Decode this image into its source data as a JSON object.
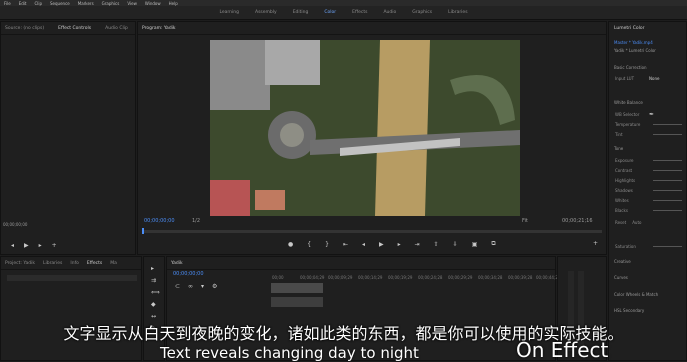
{
  "menu": [
    "File",
    "Edit",
    "Clip",
    "Sequence",
    "Markers",
    "Graphics",
    "View",
    "Window",
    "Help"
  ],
  "workspaces": [
    {
      "label": "Learning",
      "active": false
    },
    {
      "label": "Assembly",
      "active": false
    },
    {
      "label": "Editing",
      "active": false
    },
    {
      "label": "Color",
      "active": true
    },
    {
      "label": "Effects",
      "active": false
    },
    {
      "label": "Audio",
      "active": false
    },
    {
      "label": "Graphics",
      "active": false
    },
    {
      "label": "Libraries",
      "active": false
    }
  ],
  "source_panel": {
    "tabs": [
      "Source: (no clips)",
      "Effect Controls",
      "Audio Clip"
    ],
    "timecode": "00;00;00;00"
  },
  "program_panel": {
    "title": "Program: Yadik",
    "timecode": "00;00;00;00",
    "fit": "Fit",
    "duration": "00;00;21;16",
    "page": "1/2"
  },
  "project_panel": {
    "tabs": [
      "Project: Yadik",
      "Libraries",
      "Info",
      "Effects",
      "Ma"
    ]
  },
  "timeline": {
    "name": "Yadik",
    "timecode": "00;00;00;00",
    "ruler": [
      "00;00",
      "00;00;04;29",
      "00;00;09;29",
      "00;00;14;29",
      "00;00;19;29",
      "00;00;24;28",
      "00;00;29;29",
      "00;00;34;28",
      "00;00;39;28",
      "00;00;44;28"
    ]
  },
  "lumetri": {
    "title": "Lumetri Color",
    "master": "Master * Yadik.mp4",
    "clip": "Yadik * Lumetri Color",
    "section_basic": "Basic Correction",
    "input_lut_label": "Input LUT",
    "input_lut_value": "None",
    "section_wb": "White Balance",
    "wb_selector": "WB Selector",
    "temperature": "Temperature",
    "tint": "Tint",
    "section_tone": "Tone",
    "tone_rows": [
      "Exposure",
      "Contrast",
      "Highlights",
      "Shadows",
      "Whites",
      "Blacks"
    ],
    "reset": "Reset",
    "auto": "Auto",
    "saturation": "Saturation",
    "section_creative": "Creative",
    "section_curves": "Curves",
    "section_color_wheels": "Color Wheels & Match",
    "section_hsl": "HSL Secondary"
  },
  "subtitles": {
    "chinese": "文字显示从白天到夜晚的变化，诸如此类的东西，都是你可以使用的实际技能。",
    "english": "Text reveals changing day to night",
    "english_right": "On Effect"
  },
  "colors": {
    "accent": "#4b8df6",
    "timeline_clip": "#7a5a2a"
  }
}
